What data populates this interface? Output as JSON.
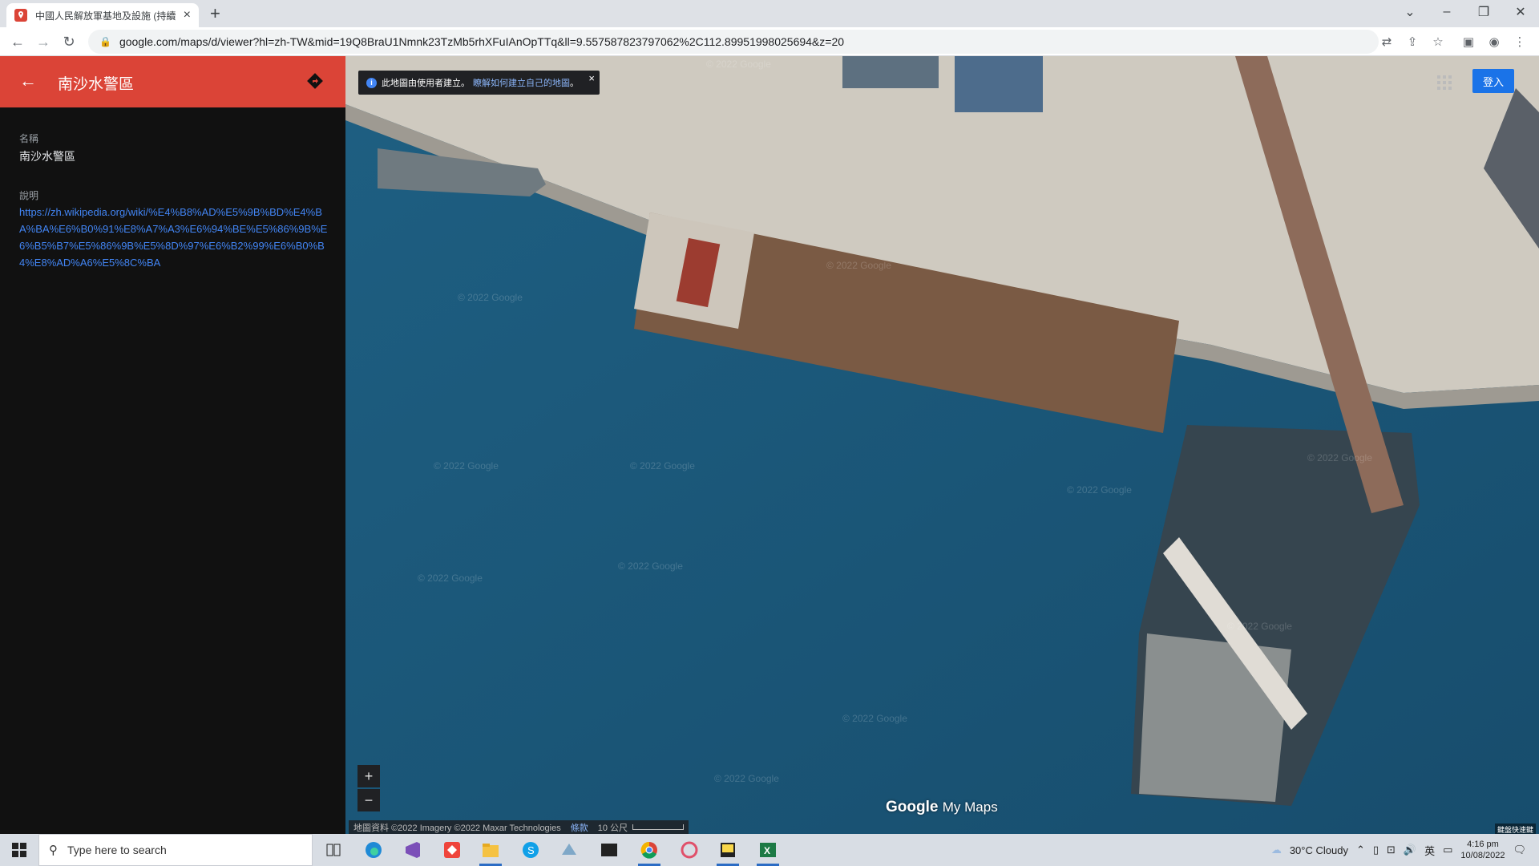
{
  "browser": {
    "tab_title": "中國人民解放軍基地及設施 (持續",
    "tab_close": "×",
    "new_tab": "+",
    "url": "google.com/maps/d/viewer?hl=zh-TW&mid=19Q8BraU1Nmnk23TzMb5rhXFuIAnOpTTq&ll=9.557587823797062%2C112.89951998025694&z=20",
    "window_controls": [
      "chevron-down-icon",
      "minimize-icon",
      "restore-icon",
      "close-icon"
    ]
  },
  "sidebar": {
    "back": "←",
    "title": "南沙水警區",
    "name_label": "名稱",
    "name_value": "南沙水警區",
    "desc_label": "說明",
    "desc_link": "https://zh.wikipedia.org/wiki/%E4%B8%AD%E5%9B%BD%E4%BA%BA%E6%B0%91%E8%A7%A3%E6%94%BE%E5%86%9B%E6%B5%B7%E5%86%9B%E5%8D%97%E6%B2%99%E6%B0%B4%E8%AD%A6%E5%8C%BA",
    "header_color": "#db4437"
  },
  "map": {
    "notice_text": "此地圖由使用者建立。",
    "notice_link": "瞭解如何建立自己的地圖",
    "notice_end": "。",
    "notice_close": "×",
    "signin": "登入",
    "zoom_in": "+",
    "zoom_out": "−",
    "logo_google": "Google",
    "logo_mymaps": "My Maps",
    "attribution": "地圖資料 ©2022 Imagery ©2022 Maxar Technologies",
    "terms": "條款",
    "scale": "10 公尺",
    "corner_text": "鍵盤快速鍵",
    "watermark": "© 2022 Google"
  },
  "taskbar": {
    "search_placeholder": "Type here to search",
    "weather": "30°C  Cloudy",
    "ime": "英",
    "time": "4:16 pm",
    "date": "10/08/2022"
  }
}
